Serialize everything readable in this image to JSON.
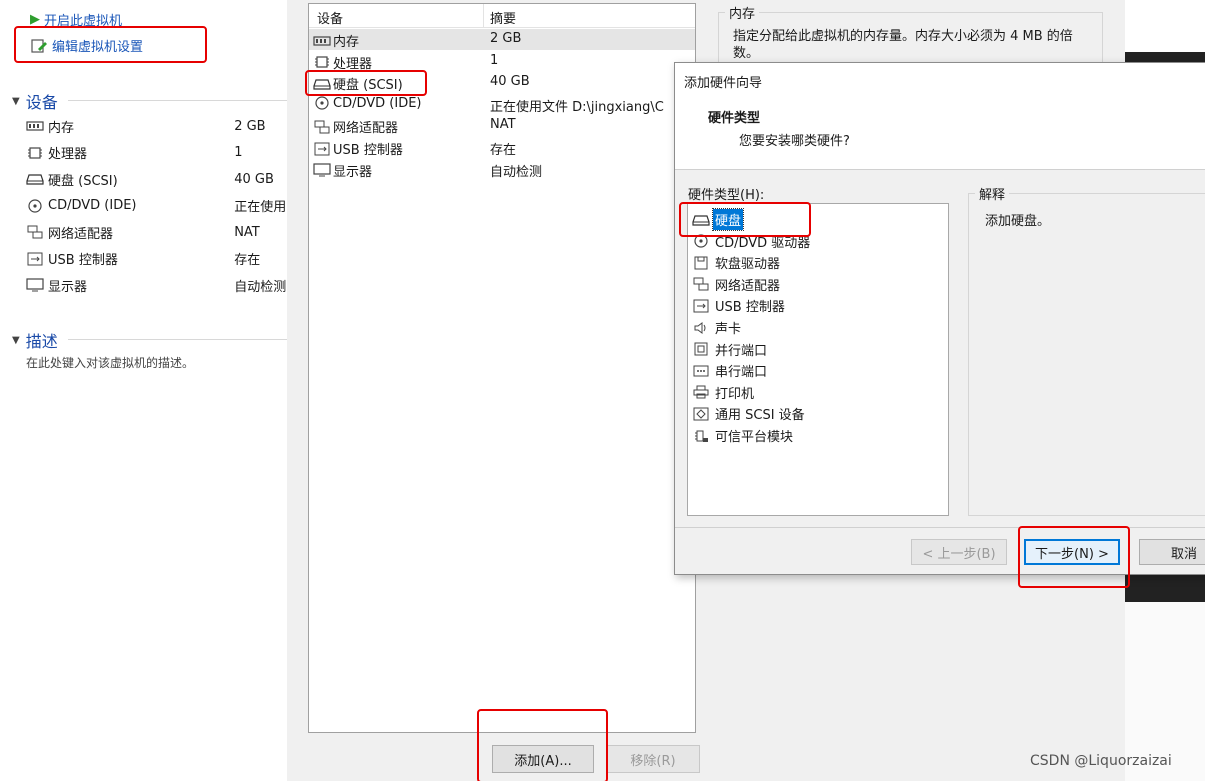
{
  "left_panel": {
    "start_vm_label": "开启此虚拟机",
    "edit_settings_label": "编辑虚拟机设置",
    "devices_heading": "设备",
    "devices": [
      {
        "icon": "memory-icon",
        "name": "内存",
        "value": "2 GB"
      },
      {
        "icon": "processor-icon",
        "name": "处理器",
        "value": "1"
      },
      {
        "icon": "harddisk-icon",
        "name": "硬盘 (SCSI)",
        "value": "40 GB"
      },
      {
        "icon": "cd-dvd-icon",
        "name": "CD/DVD (IDE)",
        "value": "正在使用"
      },
      {
        "icon": "network-adapter-icon",
        "name": "网络适配器",
        "value": "NAT"
      },
      {
        "icon": "usb-controller-icon",
        "name": "USB 控制器",
        "value": "存在"
      },
      {
        "icon": "display-icon",
        "name": "显示器",
        "value": "自动检测"
      }
    ],
    "description_heading": "描述",
    "description_placeholder": "在此处键入对该虚拟机的描述。"
  },
  "settings": {
    "col_device": "设备",
    "col_summary": "摘要",
    "devices": [
      {
        "icon": "memory-icon",
        "name": "内存",
        "value": "2 GB"
      },
      {
        "icon": "processor-icon",
        "name": "处理器",
        "value": "1"
      },
      {
        "icon": "harddisk-icon",
        "name": "硬盘 (SCSI)",
        "value": "40 GB"
      },
      {
        "icon": "cd-dvd-icon",
        "name": "CD/DVD (IDE)",
        "value": "正在使用文件 D:\\jingxiang\\C"
      },
      {
        "icon": "network-adapter-icon",
        "name": "网络适配器",
        "value": "NAT"
      },
      {
        "icon": "usb-controller-icon",
        "name": "USB 控制器",
        "value": "存在"
      },
      {
        "icon": "display-icon",
        "name": "显示器",
        "value": "自动检测"
      }
    ],
    "add_button": "添加(A)...",
    "remove_button": "移除(R)",
    "memory_group_title": "内存",
    "memory_description": "指定分配给此虚拟机的内存量。内存大小必须为 4 MB 的倍数。"
  },
  "wizard": {
    "title": "添加硬件向导",
    "heading": "硬件类型",
    "subheading": "您要安装哪类硬件?",
    "hardware_types_label": "硬件类型(H):",
    "explanation_label": "解释",
    "explanation_text": "添加硬盘。",
    "hardware_types": [
      {
        "icon": "harddisk-icon",
        "label": "硬盘"
      },
      {
        "icon": "cd-dvd-icon",
        "label": "CD/DVD 驱动器"
      },
      {
        "icon": "floppy-icon",
        "label": "软盘驱动器"
      },
      {
        "icon": "network-adapter-icon",
        "label": "网络适配器"
      },
      {
        "icon": "usb-controller-icon",
        "label": "USB 控制器"
      },
      {
        "icon": "sound-card-icon",
        "label": "声卡"
      },
      {
        "icon": "parallel-port-icon",
        "label": "并行端口"
      },
      {
        "icon": "serial-port-icon",
        "label": "串行端口"
      },
      {
        "icon": "printer-icon",
        "label": "打印机"
      },
      {
        "icon": "scsi-device-icon",
        "label": "通用 SCSI 设备"
      },
      {
        "icon": "tpm-icon",
        "label": "可信平台模块"
      }
    ],
    "back_button": "< 上一步(B)",
    "next_button": "下一步(N) >",
    "cancel_button": "取消"
  },
  "watermark": "CSDN @Liquorzaizai",
  "colors": {
    "accent": "#1a56b8",
    "selection": "#0078d7",
    "highlight_box": "#e60000",
    "play_green": "#2e9e2e"
  }
}
